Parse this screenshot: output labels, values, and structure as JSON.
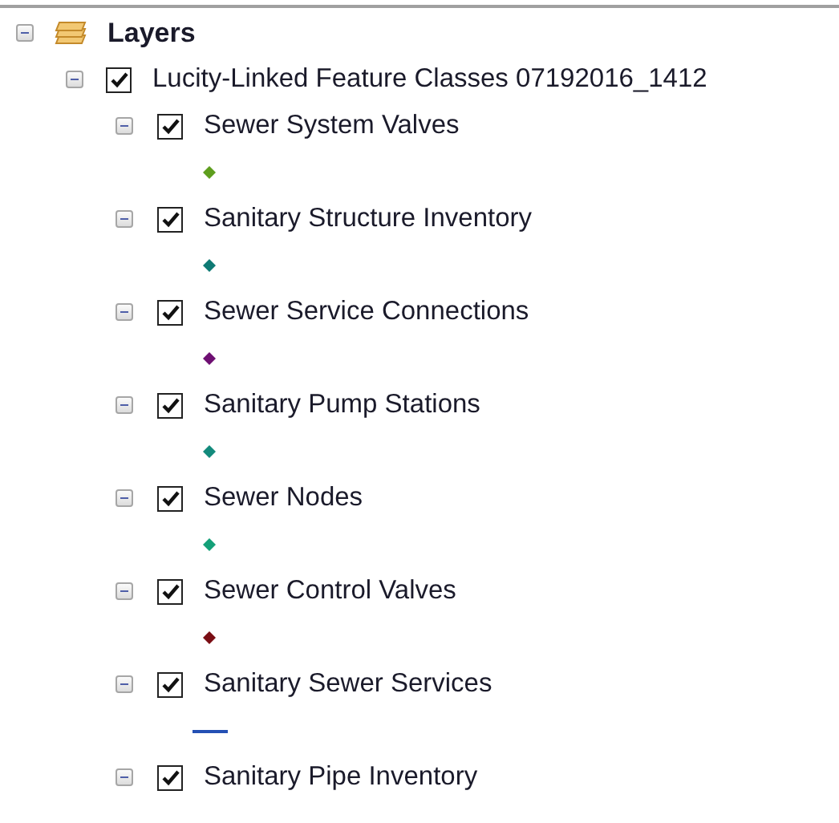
{
  "toc": {
    "label": "Layers",
    "expanded": true,
    "children": [
      {
        "label": "Lucity-Linked Feature Classes 07192016_1412",
        "checked": true,
        "expanded": true,
        "children": [
          {
            "label": "Sewer System Valves",
            "checked": true,
            "expanded": true,
            "symbol": {
              "kind": "point",
              "color": "#5e9e1e"
            }
          },
          {
            "label": "Sanitary Structure Inventory",
            "checked": true,
            "expanded": true,
            "symbol": {
              "kind": "point",
              "color": "#0e7a74"
            }
          },
          {
            "label": "Sewer Service Connections",
            "checked": true,
            "expanded": true,
            "symbol": {
              "kind": "point",
              "color": "#6e0f72"
            }
          },
          {
            "label": "Sanitary Pump Stations",
            "checked": true,
            "expanded": true,
            "symbol": {
              "kind": "point",
              "color": "#138a7c"
            }
          },
          {
            "label": "Sewer Nodes",
            "checked": true,
            "expanded": true,
            "symbol": {
              "kind": "point",
              "color": "#14a078"
            }
          },
          {
            "label": "Sewer Control Valves",
            "checked": true,
            "expanded": true,
            "symbol": {
              "kind": "point",
              "color": "#7a0d14"
            }
          },
          {
            "label": "Sanitary Sewer Services",
            "checked": true,
            "expanded": true,
            "symbol": {
              "kind": "line",
              "color": "#2450b4"
            }
          },
          {
            "label": "Sanitary Pipe Inventory",
            "checked": true,
            "expanded": true
          }
        ]
      }
    ]
  }
}
